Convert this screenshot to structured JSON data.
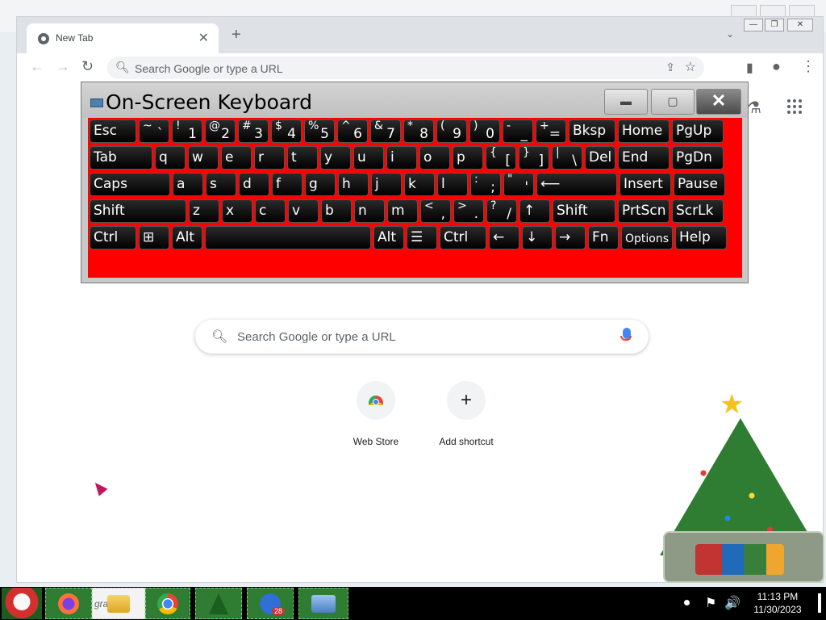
{
  "browser": {
    "tab_title": "New Tab",
    "tab_close": "✕",
    "new_tab": "+",
    "tab_menu": "⌄",
    "window_min": "—",
    "window_max": "❐",
    "window_close": "✕",
    "omnibox_placeholder": "Search Google or type a URL",
    "nav_back": "←",
    "nav_forward": "→",
    "nav_reload": "↻",
    "side_panel": "▮",
    "profile": "●",
    "menu": "⋮",
    "share": "⇪",
    "bookmark": "☆"
  },
  "ntp": {
    "search_placeholder": "Search Google or type a URL",
    "labs": "⚗",
    "shortcuts": [
      {
        "label": "Web Store"
      },
      {
        "label": "Add shortcut",
        "glyph": "+"
      }
    ]
  },
  "osk": {
    "title": "On-Screen Keyboard",
    "min": "▬",
    "max": "▢",
    "close": "✕",
    "rows": [
      [
        {
          "main": "Esc"
        },
        {
          "top": "~",
          "sub": "`"
        },
        {
          "top": "!",
          "sub": "1"
        },
        {
          "top": "@",
          "sub": "2"
        },
        {
          "top": "#",
          "sub": "3"
        },
        {
          "top": "$",
          "sub": "4"
        },
        {
          "top": "%",
          "sub": "5"
        },
        {
          "top": "^",
          "sub": "6"
        },
        {
          "top": "&",
          "sub": "7"
        },
        {
          "top": "*",
          "sub": "8"
        },
        {
          "top": "(",
          "sub": "9"
        },
        {
          "top": ")",
          "sub": "0"
        },
        {
          "top": "-",
          "sub": "_"
        },
        {
          "top": "+",
          "sub": "="
        },
        {
          "main": "Bksp"
        },
        {
          "main": "Home"
        },
        {
          "main": "PgUp"
        }
      ],
      [
        {
          "main": "Tab"
        },
        {
          "main": "q"
        },
        {
          "main": "w"
        },
        {
          "main": "e"
        },
        {
          "main": "r"
        },
        {
          "main": "t"
        },
        {
          "main": "y"
        },
        {
          "main": "u"
        },
        {
          "main": "i"
        },
        {
          "main": "o"
        },
        {
          "main": "p"
        },
        {
          "top": "{",
          "sub": "["
        },
        {
          "top": "}",
          "sub": "]"
        },
        {
          "top": "|",
          "sub": "\\"
        },
        {
          "main": "Del"
        },
        {
          "main": "End"
        },
        {
          "main": "PgDn"
        }
      ],
      [
        {
          "main": "Caps"
        },
        {
          "main": "a"
        },
        {
          "main": "s"
        },
        {
          "main": "d"
        },
        {
          "main": "f"
        },
        {
          "main": "g"
        },
        {
          "main": "h"
        },
        {
          "main": "j"
        },
        {
          "main": "k"
        },
        {
          "main": "l"
        },
        {
          "top": ":",
          "sub": ";"
        },
        {
          "top": "\"",
          "sub": "'"
        },
        {
          "main": "⟵"
        },
        {
          "main": "Insert"
        },
        {
          "main": "Pause"
        }
      ],
      [
        {
          "main": "Shift"
        },
        {
          "main": "z"
        },
        {
          "main": "x"
        },
        {
          "main": "c"
        },
        {
          "main": "v"
        },
        {
          "main": "b"
        },
        {
          "main": "n"
        },
        {
          "main": "m"
        },
        {
          "top": "<",
          "sub": ","
        },
        {
          "top": ">",
          "sub": "."
        },
        {
          "top": "?",
          "sub": "/"
        },
        {
          "main": "↑"
        },
        {
          "main": "Shift"
        },
        {
          "main": "PrtScn"
        },
        {
          "main": "ScrLk"
        }
      ],
      [
        {
          "main": "Ctrl"
        },
        {
          "main": "⊞"
        },
        {
          "main": "Alt"
        },
        {
          "main": ""
        },
        {
          "main": "Alt"
        },
        {
          "main": "☰"
        },
        {
          "main": "Ctrl"
        },
        {
          "main": "←"
        },
        {
          "main": "↓"
        },
        {
          "main": "→"
        },
        {
          "main": "Fn"
        },
        {
          "main": "Options"
        },
        {
          "main": "Help"
        }
      ]
    ]
  },
  "taskbar": {
    "explorer_text": "gra",
    "time": "11:13 PM",
    "date": "11/30/2023",
    "tray_flag": "⚑",
    "tray_volume": "🔊",
    "badge": "28"
  }
}
